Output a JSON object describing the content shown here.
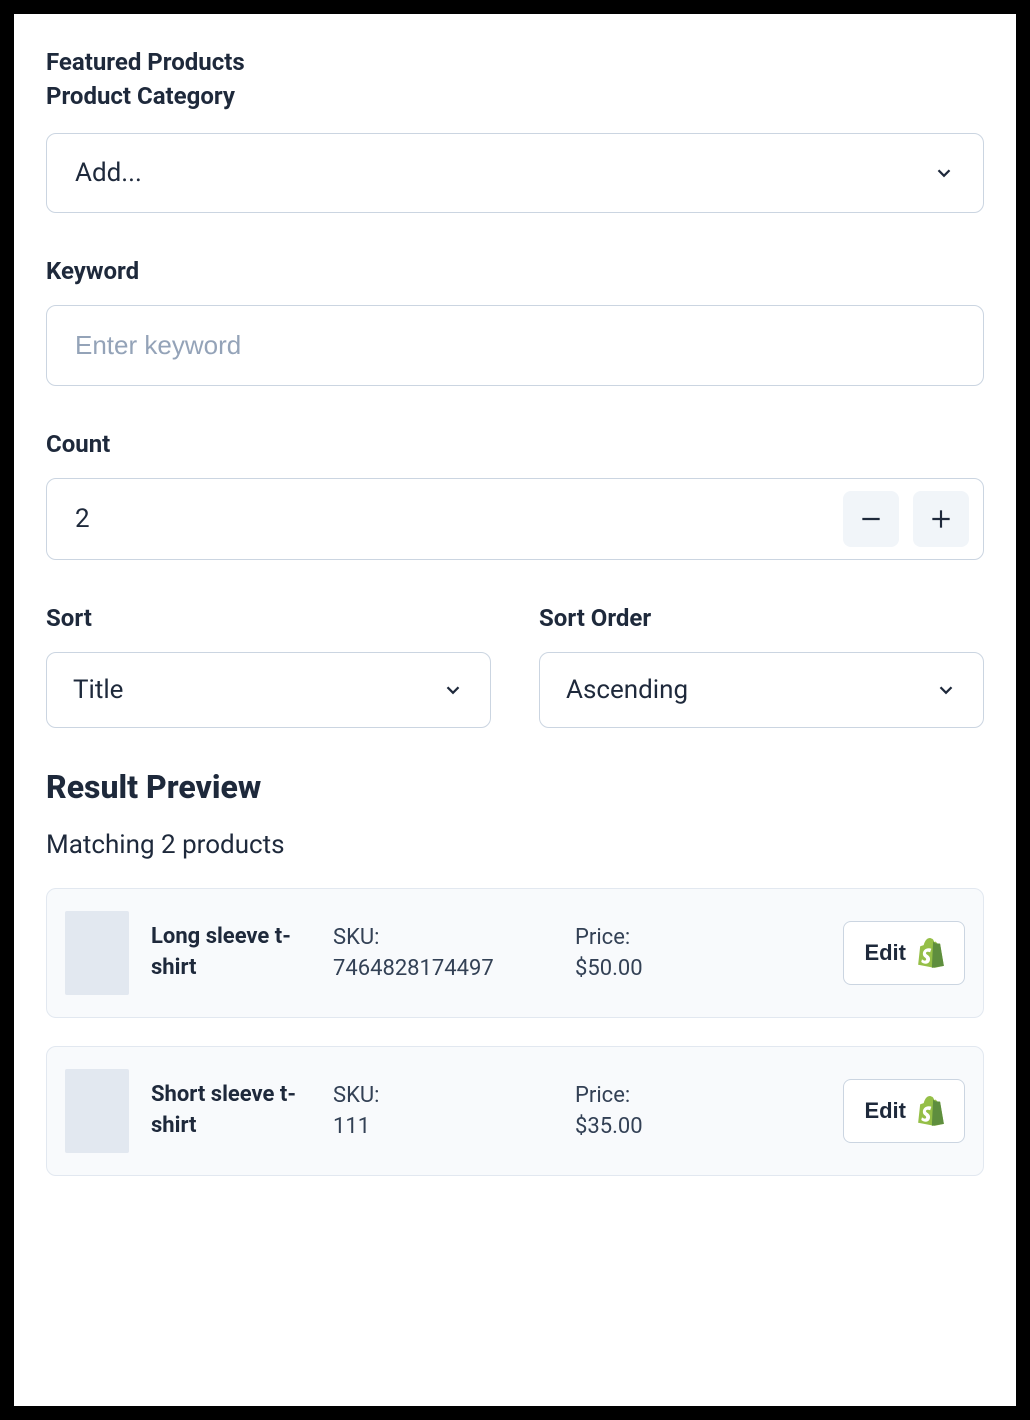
{
  "header": {
    "title1": "Featured Products",
    "title2": "Product Category"
  },
  "category": {
    "placeholder": "Add..."
  },
  "keyword": {
    "label": "Keyword",
    "placeholder": "Enter keyword",
    "value": ""
  },
  "count": {
    "label": "Count",
    "value": "2"
  },
  "sort": {
    "label": "Sort",
    "value": "Title"
  },
  "sortOrder": {
    "label": "Sort Order",
    "value": "Ascending"
  },
  "results": {
    "heading": "Result Preview",
    "subheading": "Matching 2 products"
  },
  "sku_label": "SKU:",
  "price_label": "Price:",
  "edit_label": "Edit",
  "products": [
    {
      "title": "Long sleeve t-shirt",
      "sku": "7464828174497",
      "price": "$50.00"
    },
    {
      "title": "Short sleeve t-shirt",
      "sku": "111",
      "price": "$35.00"
    }
  ]
}
